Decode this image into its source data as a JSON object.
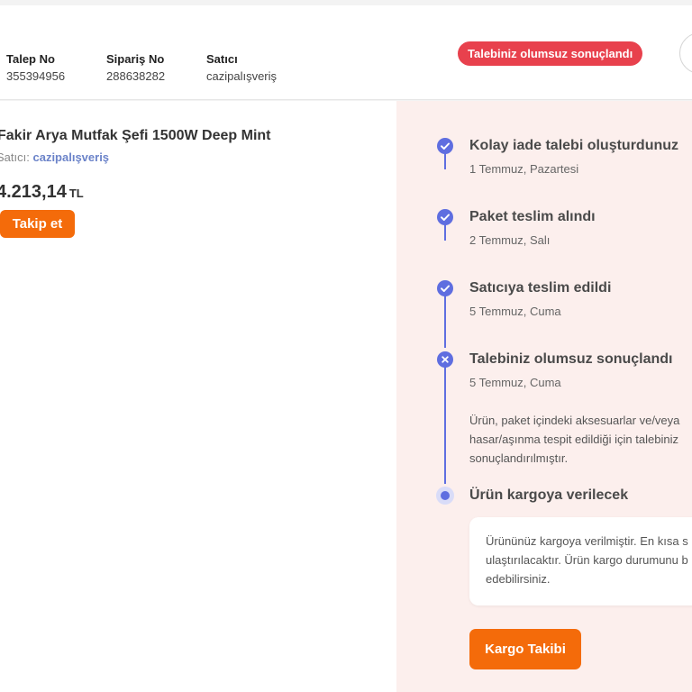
{
  "header": {
    "fields": [
      {
        "label": "Talep No",
        "value": "355394956"
      },
      {
        "label": "Sipariş No",
        "value": "288638282"
      },
      {
        "label": "Satıcı",
        "value": "cazipalışveriş"
      }
    ],
    "status_badge": "Talebiniz olumsuz sonuçlandı",
    "status_color": "#e8414d",
    "avatar_icon": "shopping-bag-icon"
  },
  "product": {
    "name": "Fakir Arya Mutfak Şefi 1500W Deep Mint",
    "seller_label": "Satıcı:",
    "seller_name": "cazipalışveriş",
    "price": "4.213,14",
    "currency": "TL",
    "follow_label": "Takip et"
  },
  "timeline": {
    "accent_color": "#5f6ee0",
    "steps": [
      {
        "title": "Kolay iade talebi oluşturdunuz",
        "date": "1 Temmuz, Pazartesi",
        "icon": "check-icon"
      },
      {
        "title": "Paket teslim alındı",
        "date": "2 Temmuz, Salı",
        "icon": "check-icon"
      },
      {
        "title": "Satıcıya teslim edildi",
        "date": "5 Temmuz, Cuma",
        "icon": "check-icon"
      },
      {
        "title": "Talebiniz olumsuz sonuçlandı",
        "date": "5 Temmuz, Cuma",
        "icon": "close-icon",
        "note": "Ürün, paket içindeki aksesuarlar ve/veya hasar/aşınma tespit edildiği için talebiniz sonuçlandırılmıştır."
      },
      {
        "title": "Ürün kargoya verilecek",
        "icon": "current-dot-icon",
        "info": "Ürününüz kargoya verilmiştir. En kısa s ulaştırılacaktır. Ürün kargo durumunu b edebilirsiniz."
      }
    ],
    "cargo_button": "Kargo Takibi"
  },
  "brand": {
    "orange": "#f46b0a"
  }
}
